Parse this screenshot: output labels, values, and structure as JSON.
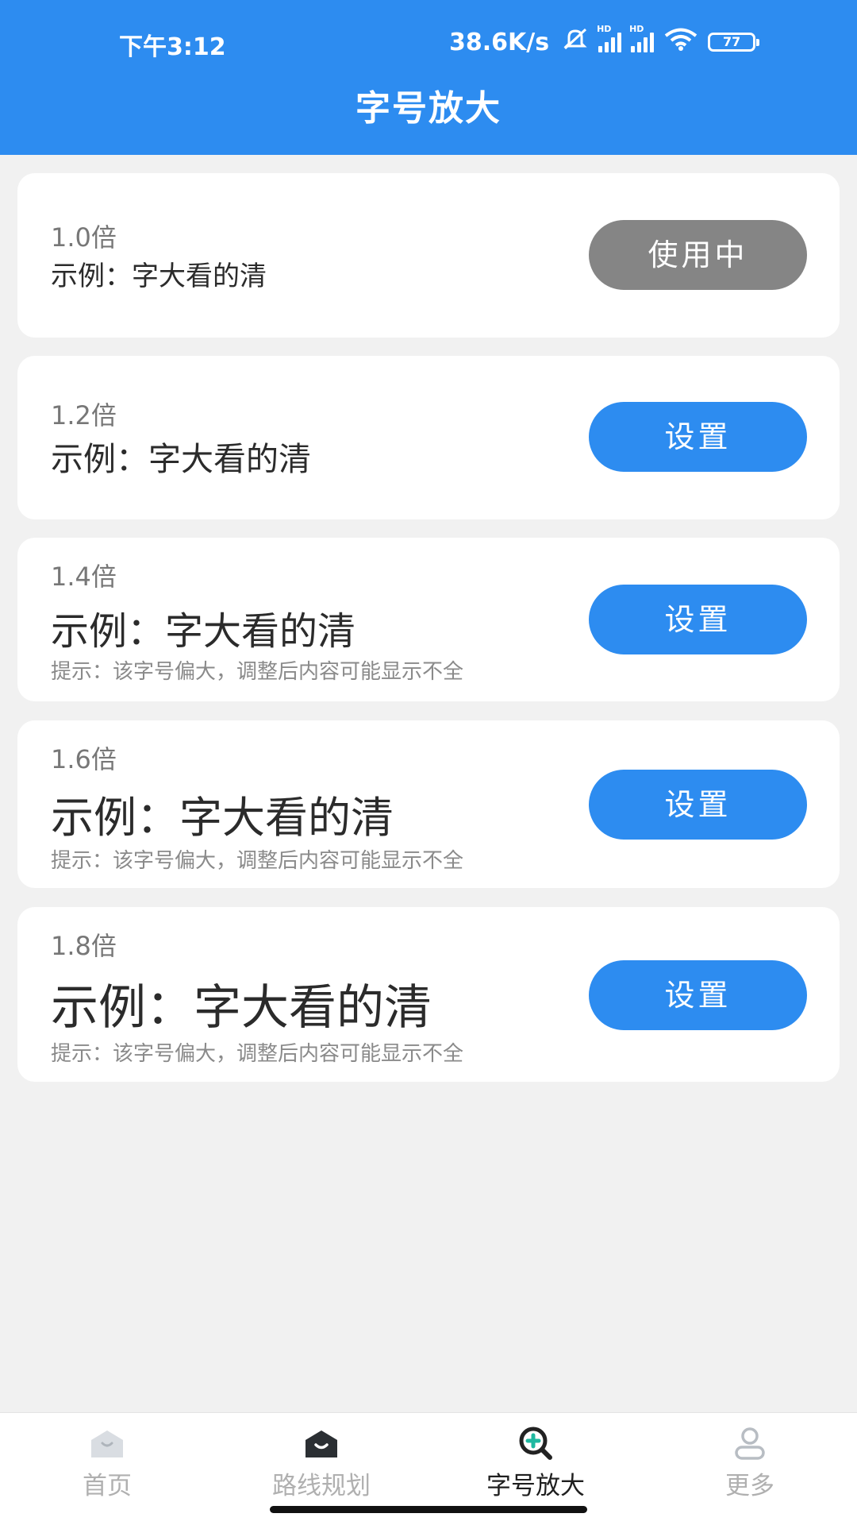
{
  "status_bar": {
    "time": "下午3:12",
    "speed": "38.6K/s",
    "battery": "77",
    "sim1_label": "HD",
    "sim2_label": "HD"
  },
  "header": {
    "title": "字号放大"
  },
  "options": [
    {
      "multiplier": "1.0倍",
      "example": "示例：字大看的清",
      "button": "使用中",
      "state": "active"
    },
    {
      "multiplier": "1.2倍",
      "example": "示例：字大看的清",
      "button": "设置",
      "state": "available"
    },
    {
      "multiplier": "1.4倍",
      "example": "示例：字大看的清",
      "button": "设置",
      "state": "available",
      "hint": "提示：该字号偏大，调整后内容可能显示不全"
    },
    {
      "multiplier": "1.6倍",
      "example": "示例：字大看的清",
      "button": "设置",
      "state": "available",
      "hint": "提示：该字号偏大，调整后内容可能显示不全"
    },
    {
      "multiplier": "1.8倍",
      "example": "示例：字大看的清",
      "button": "设置",
      "state": "available",
      "hint": "提示：该字号偏大，调整后内容可能显示不全"
    }
  ],
  "nav": {
    "items": [
      {
        "label": "首页",
        "icon": "home-icon"
      },
      {
        "label": "路线规划",
        "icon": "route-icon"
      },
      {
        "label": "字号放大",
        "icon": "zoom-plus-icon"
      },
      {
        "label": "更多",
        "icon": "person-icon"
      }
    ],
    "active_index": 2
  },
  "colors": {
    "primary": "#2d8cf0",
    "active_button": "#858585",
    "background": "#f1f1f1"
  }
}
